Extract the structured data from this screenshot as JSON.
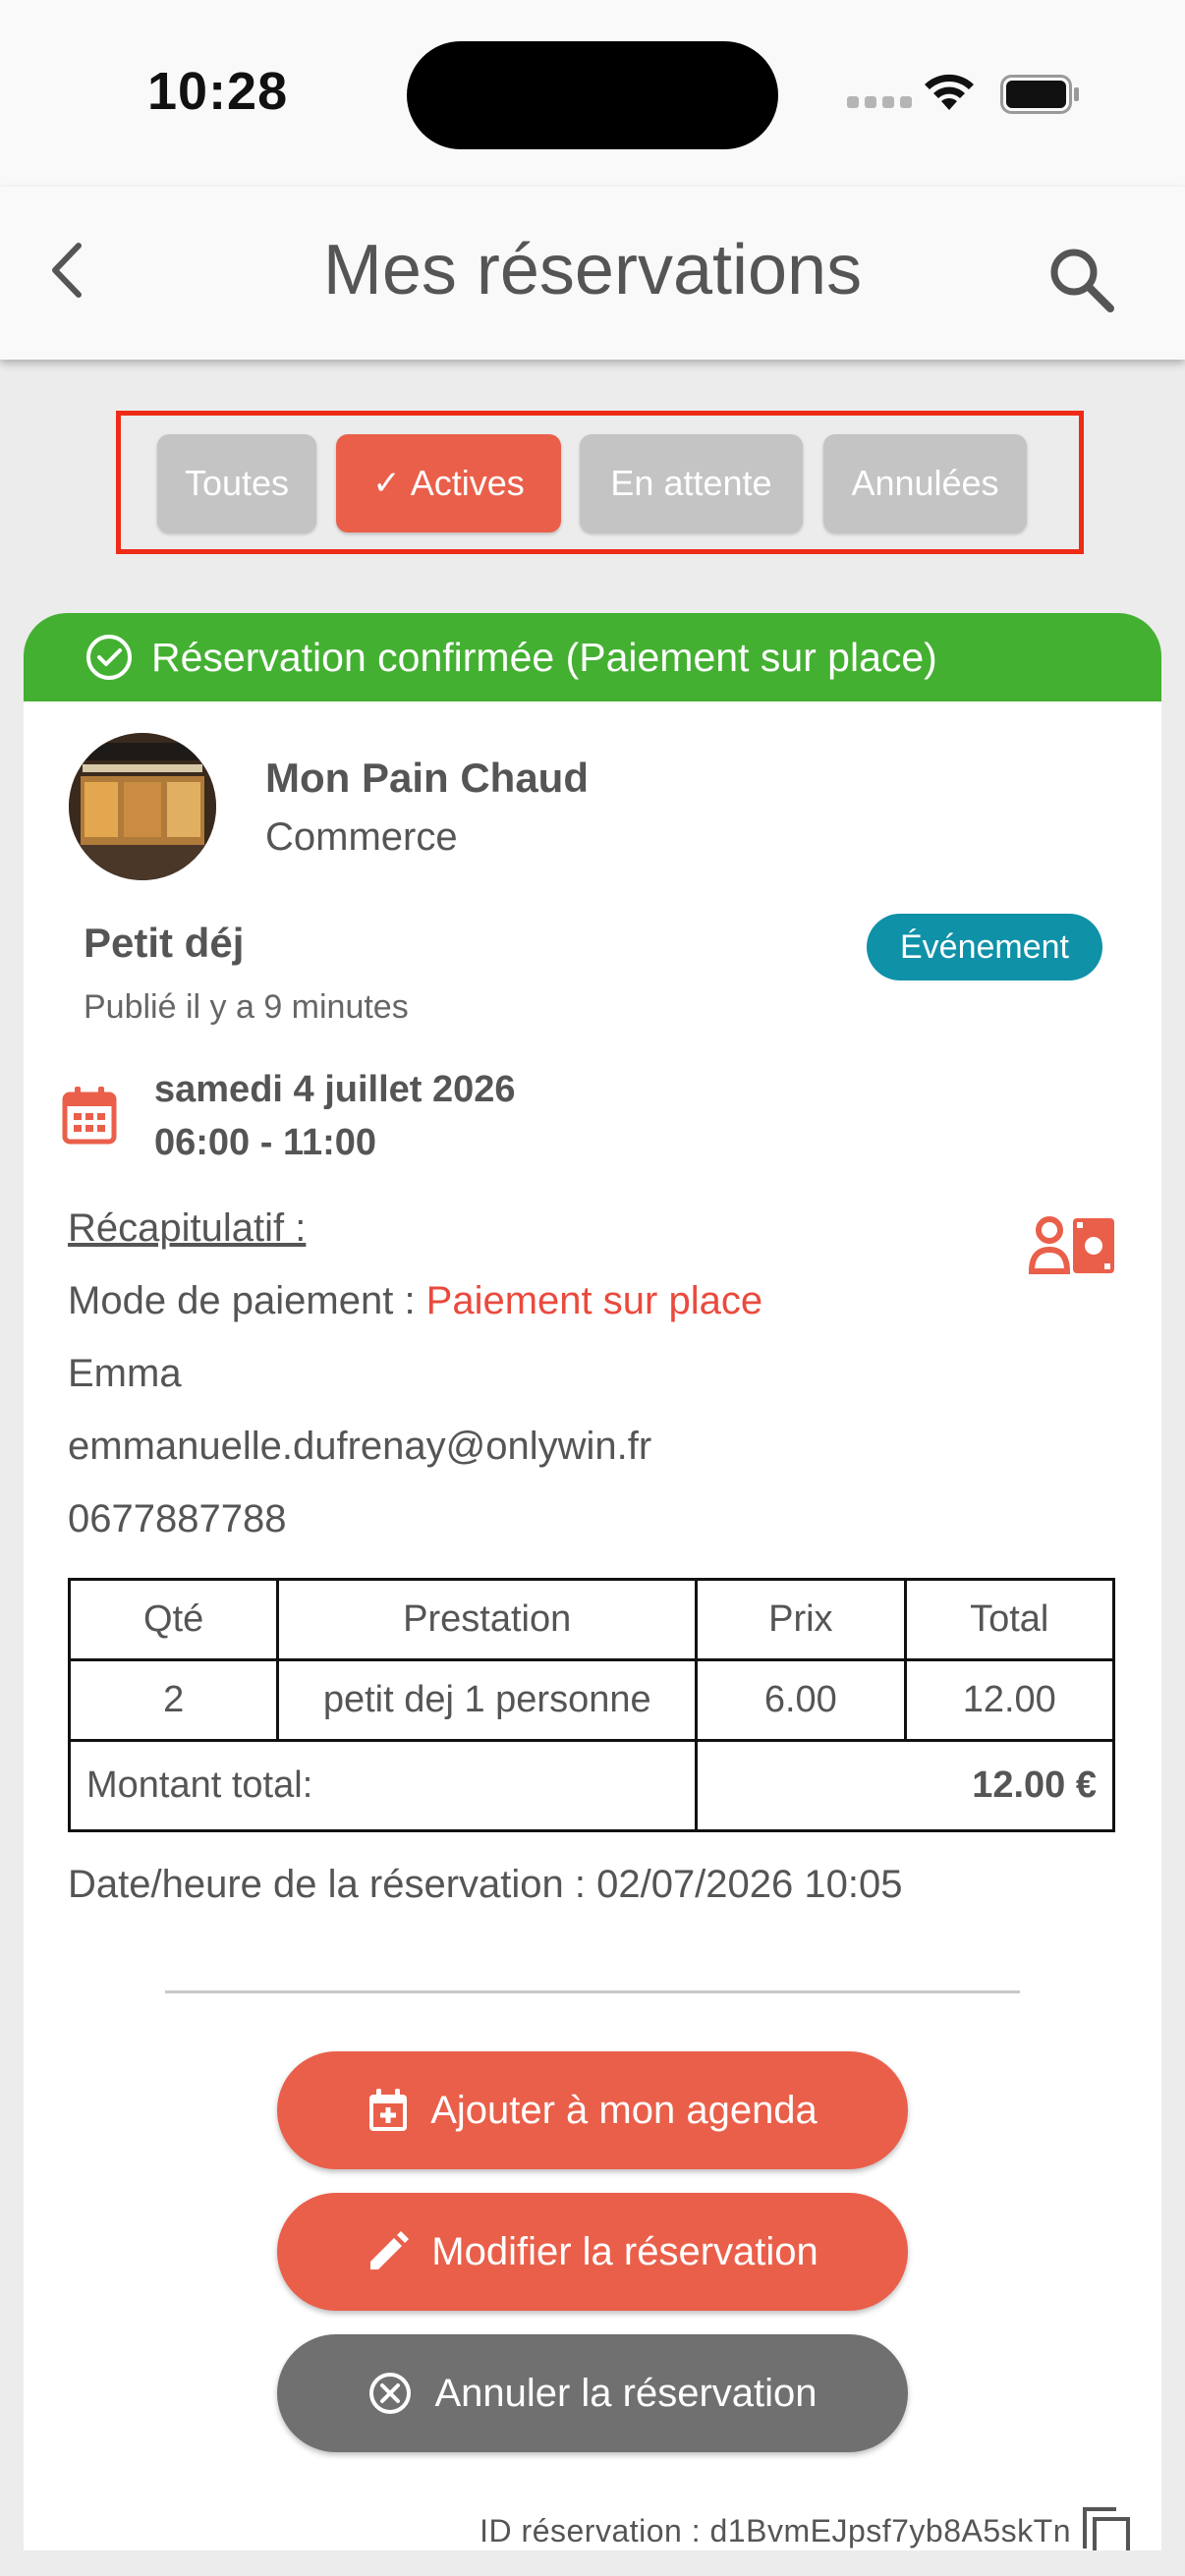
{
  "status_bar": {
    "time": "10:28"
  },
  "header": {
    "title": "Mes réservations"
  },
  "filters": [
    {
      "label": "Toutes",
      "active": false
    },
    {
      "label": "Actives",
      "active": true
    },
    {
      "label": "En attente",
      "active": false
    },
    {
      "label": "Annulées",
      "active": false
    }
  ],
  "reservation": {
    "status_banner": "Réservation confirmée (Paiement sur place)",
    "shop_name": "Mon Pain Chaud",
    "shop_type": "Commerce",
    "offer_title": "Petit déj",
    "badge": "Événement",
    "published": "Publié il y a 9 minutes",
    "date": "samedi 4 juillet 2026",
    "hours": "06:00 - 11:00",
    "recap_label": "Récapitulatif :",
    "payment_label": "Mode de paiement : ",
    "payment_value": "Paiement sur place",
    "customer_name": "Emma",
    "customer_email": "emmanuelle.dufrenay@onlywin.fr",
    "customer_phone": "0677887788",
    "table": {
      "headers": [
        "Qté",
        "Prestation",
        "Prix",
        "Total"
      ],
      "rows": [
        [
          "2",
          "petit dej 1 personne",
          "6.00",
          "12.00"
        ]
      ],
      "total_label": "Montant total:",
      "total_value": "12.00 €"
    },
    "booking_datetime": "Date/heure de la réservation : 02/07/2026 10:05",
    "buttons": {
      "add_calendar": "Ajouter à mon agenda",
      "modify": "Modifier la réservation",
      "cancel": "Annuler la réservation"
    },
    "reservation_id": "ID réservation : d1BvmEJpsf7yb8A5skTn"
  },
  "colors": {
    "accent": "#ea5f4a",
    "confirmed": "#44b032",
    "badge": "#0f91a8",
    "highlight_box": "#ee2b16",
    "neutral_button": "#707070"
  }
}
